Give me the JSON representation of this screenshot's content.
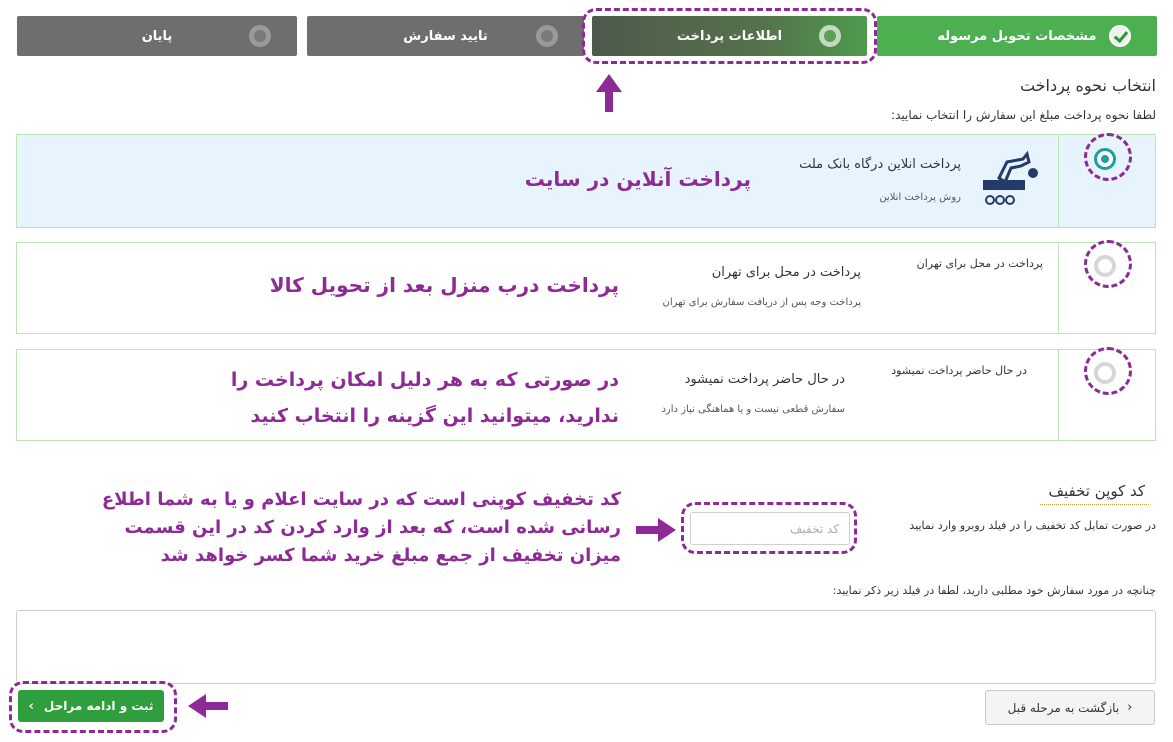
{
  "steps": [
    {
      "label": "مشخصات تحویل مرسوله",
      "state": "done"
    },
    {
      "label": "اطلاعات پرداخت",
      "state": "active"
    },
    {
      "label": "تایید سفارش",
      "state": "pending"
    },
    {
      "label": "پایان",
      "state": "pending"
    }
  ],
  "section": {
    "title": "انتخاب نحوه پرداخت",
    "subtitle": "لطفا نحوه پرداخت مبلغ این سفارش را انتخاب نمایید:"
  },
  "payment_options": [
    {
      "title": "پرداخت انلاین درگاه بانک ملت",
      "desc": "روش پرداخت انلاین",
      "selected": true,
      "annotation": "پرداخت آنلاین در سایت"
    },
    {
      "heading": "پرداخت در محل برای تهران",
      "title": "پرداخت در محل برای تهران",
      "desc": "پرداخت وجه پس از دریافت سفارش برای تهران",
      "selected": false,
      "annotation": "پرداخت درب منزل بعد از تحویل کالا"
    },
    {
      "heading": "در حال حاضر پرداخت نمیشود",
      "title": "در حال حاضر پرداخت نمیشود",
      "desc": "سفارش قطعی نیست و یا هماهنگی نیاز دارد",
      "selected": false,
      "annotation_line1": "در صورتی که به هر دلیل امکان پرداخت را",
      "annotation_line2": "ندارید، میتوانید این گزینه را انتخاب کنید"
    }
  ],
  "coupon": {
    "title": "کد کوپن تخفیف",
    "instruction": "در صورت تمایل کد تخفیف را در فیلد روبرو وارد نمایید",
    "placeholder": "کد تخفیف",
    "annotation_line1": "کد تخفیف کوپنی است که در سایت اعلام و یا به شما اطلاع",
    "annotation_line2": "رسانی شده است، که بعد از وارد کردن کد در این قسمت",
    "annotation_line3": "میزان تخفیف از جمع مبلغ خرید شما کسر خواهد شد"
  },
  "notes": {
    "label": "چنانچه در مورد سفارش خود مطلبی دارید، لطفا در فیلد زیر ذکر نمایید:"
  },
  "buttons": {
    "submit": "ثبت و ادامه مراحل",
    "back": "بازگشت به مرحله قبل"
  },
  "colors": {
    "step_done": "#4caf50",
    "step_pending": "#6e6e6e",
    "annotation": "#8e2a96",
    "selected_panel": "#e8f4fd",
    "submit_button": "#2f9e3d"
  }
}
